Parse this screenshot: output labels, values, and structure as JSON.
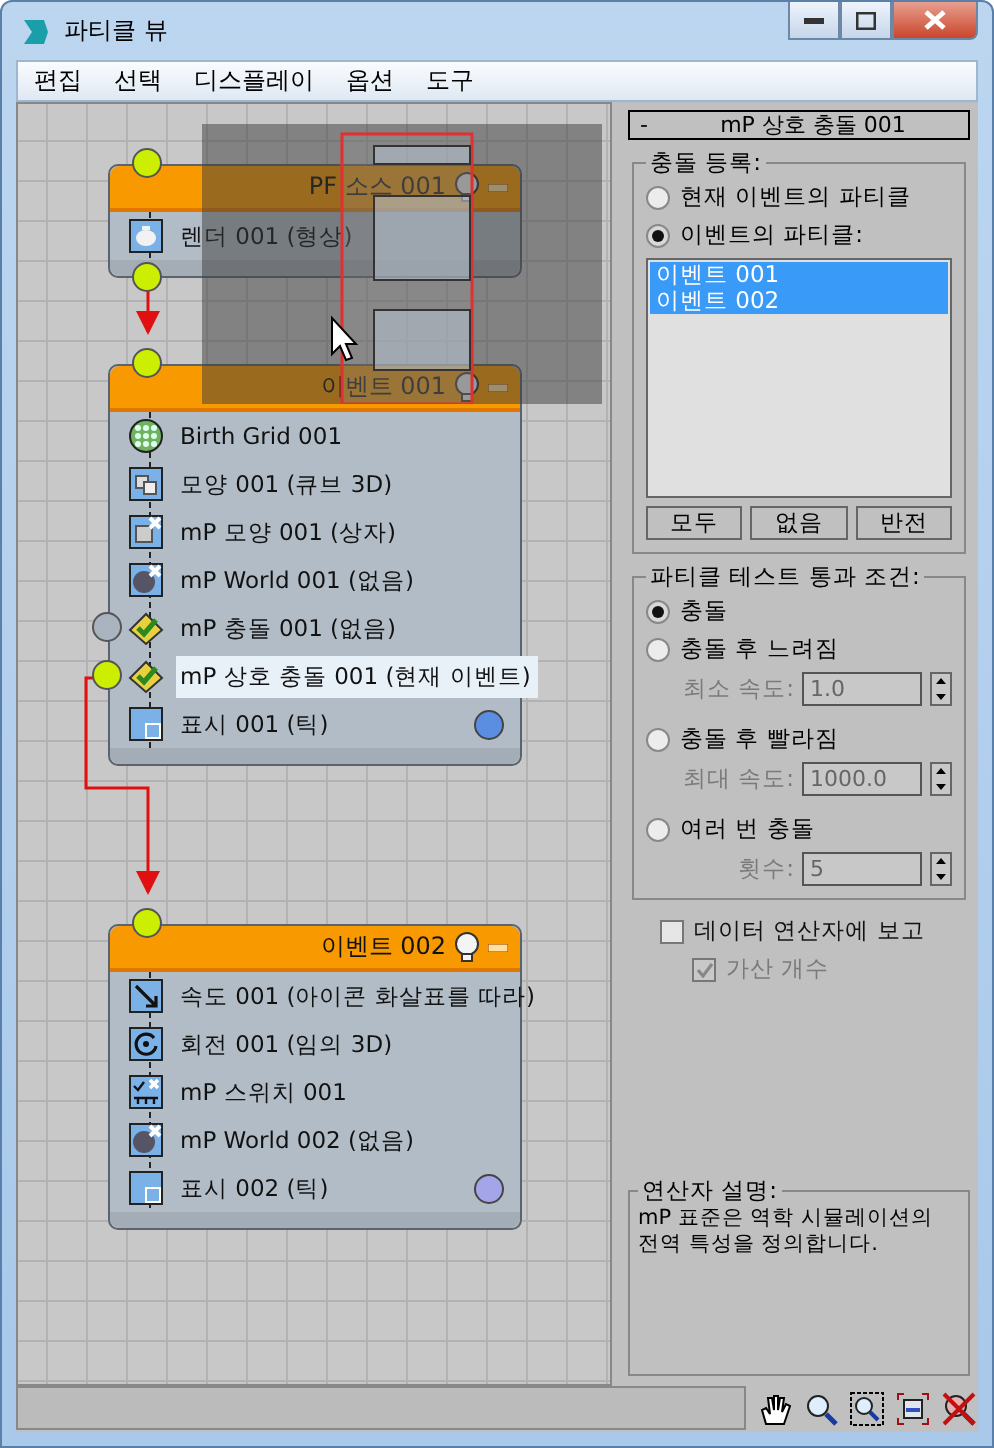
{
  "window": {
    "title": "파티클 뷰"
  },
  "menu": [
    "편집",
    "선택",
    "디스플레이",
    "옵션",
    "도구"
  ],
  "nodes": [
    {
      "title": "PF 소스 001",
      "rows": [
        {
          "label": "렌더 001 (형상)",
          "kind": "render",
          "selected": false
        }
      ],
      "output_port": {
        "connected": true
      }
    },
    {
      "title": "이벤트 001",
      "rows": [
        {
          "label": "Birth Grid 001",
          "kind": "birth",
          "selected": false
        },
        {
          "label": "모양 001 (큐브 3D)",
          "kind": "shape",
          "selected": false
        },
        {
          "label": "mP 모양 001 (상자)",
          "kind": "mpshape",
          "selected": false
        },
        {
          "label": "mP World 001 (없음)",
          "kind": "world",
          "selected": false
        },
        {
          "label": "mP 충돌 001 (없음)",
          "kind": "collision",
          "selected": false,
          "port": {
            "connected": false
          }
        },
        {
          "label": "mP 상호 충돌 001 (현재 이벤트)",
          "kind": "collision",
          "selected": true,
          "port": {
            "connected": true
          }
        },
        {
          "label": "표시 001 (틱)",
          "kind": "display",
          "selected": false,
          "color": "#5b8de0"
        }
      ]
    },
    {
      "title": "이벤트 002",
      "rows": [
        {
          "label": "속도 001 (아이콘 화살표를 따라)",
          "kind": "speed",
          "selected": false
        },
        {
          "label": "회전 001 (임의 3D)",
          "kind": "spin",
          "selected": false
        },
        {
          "label": "mP 스위치  001",
          "kind": "switch",
          "selected": false
        },
        {
          "label": "mP World 002 (없음)",
          "kind": "world",
          "selected": false
        },
        {
          "label": "표시 002 (틱)",
          "kind": "display",
          "selected": false,
          "color": "#a4a4e8"
        }
      ]
    }
  ],
  "rollout": {
    "toggle": "-",
    "title": "mP 상호 충돌 001"
  },
  "register": {
    "label": "충돌 등록:",
    "options": [
      {
        "label": "현재 이벤트의 파티클",
        "selected": false
      },
      {
        "label": "이벤트의 파티클:",
        "selected": true
      }
    ],
    "list": [
      {
        "label": "이벤트 001",
        "selected": true
      },
      {
        "label": "이벤트 002",
        "selected": true
      }
    ],
    "buttons": [
      "모두",
      "없음",
      "반전"
    ]
  },
  "test": {
    "label": "파티클 테스트 통과 조건:",
    "options": [
      {
        "label": "충돌",
        "selected": true
      },
      {
        "label": "충돌 후 느려짐",
        "selected": false,
        "field": {
          "label": "최소 속도:",
          "value": "1.0",
          "disabled": true
        }
      },
      {
        "label": "충돌 후 빨라짐",
        "selected": false,
        "field": {
          "label": "최대 속도:",
          "value": "1000.0",
          "disabled": true
        }
      },
      {
        "label": "여러 번 충돌",
        "selected": false,
        "field": {
          "label": "횟수:",
          "value": "5",
          "disabled": true
        }
      }
    ]
  },
  "checks": [
    {
      "label": "데이터 연산자에 보고",
      "checked": false,
      "disabled": false
    },
    {
      "label": "가산 개수",
      "checked": true,
      "disabled": true
    }
  ],
  "description": {
    "label": "연산자 설명:",
    "text": "mP 표준은 역학 시뮬레이션의 전역 특성을 정의합니다."
  }
}
